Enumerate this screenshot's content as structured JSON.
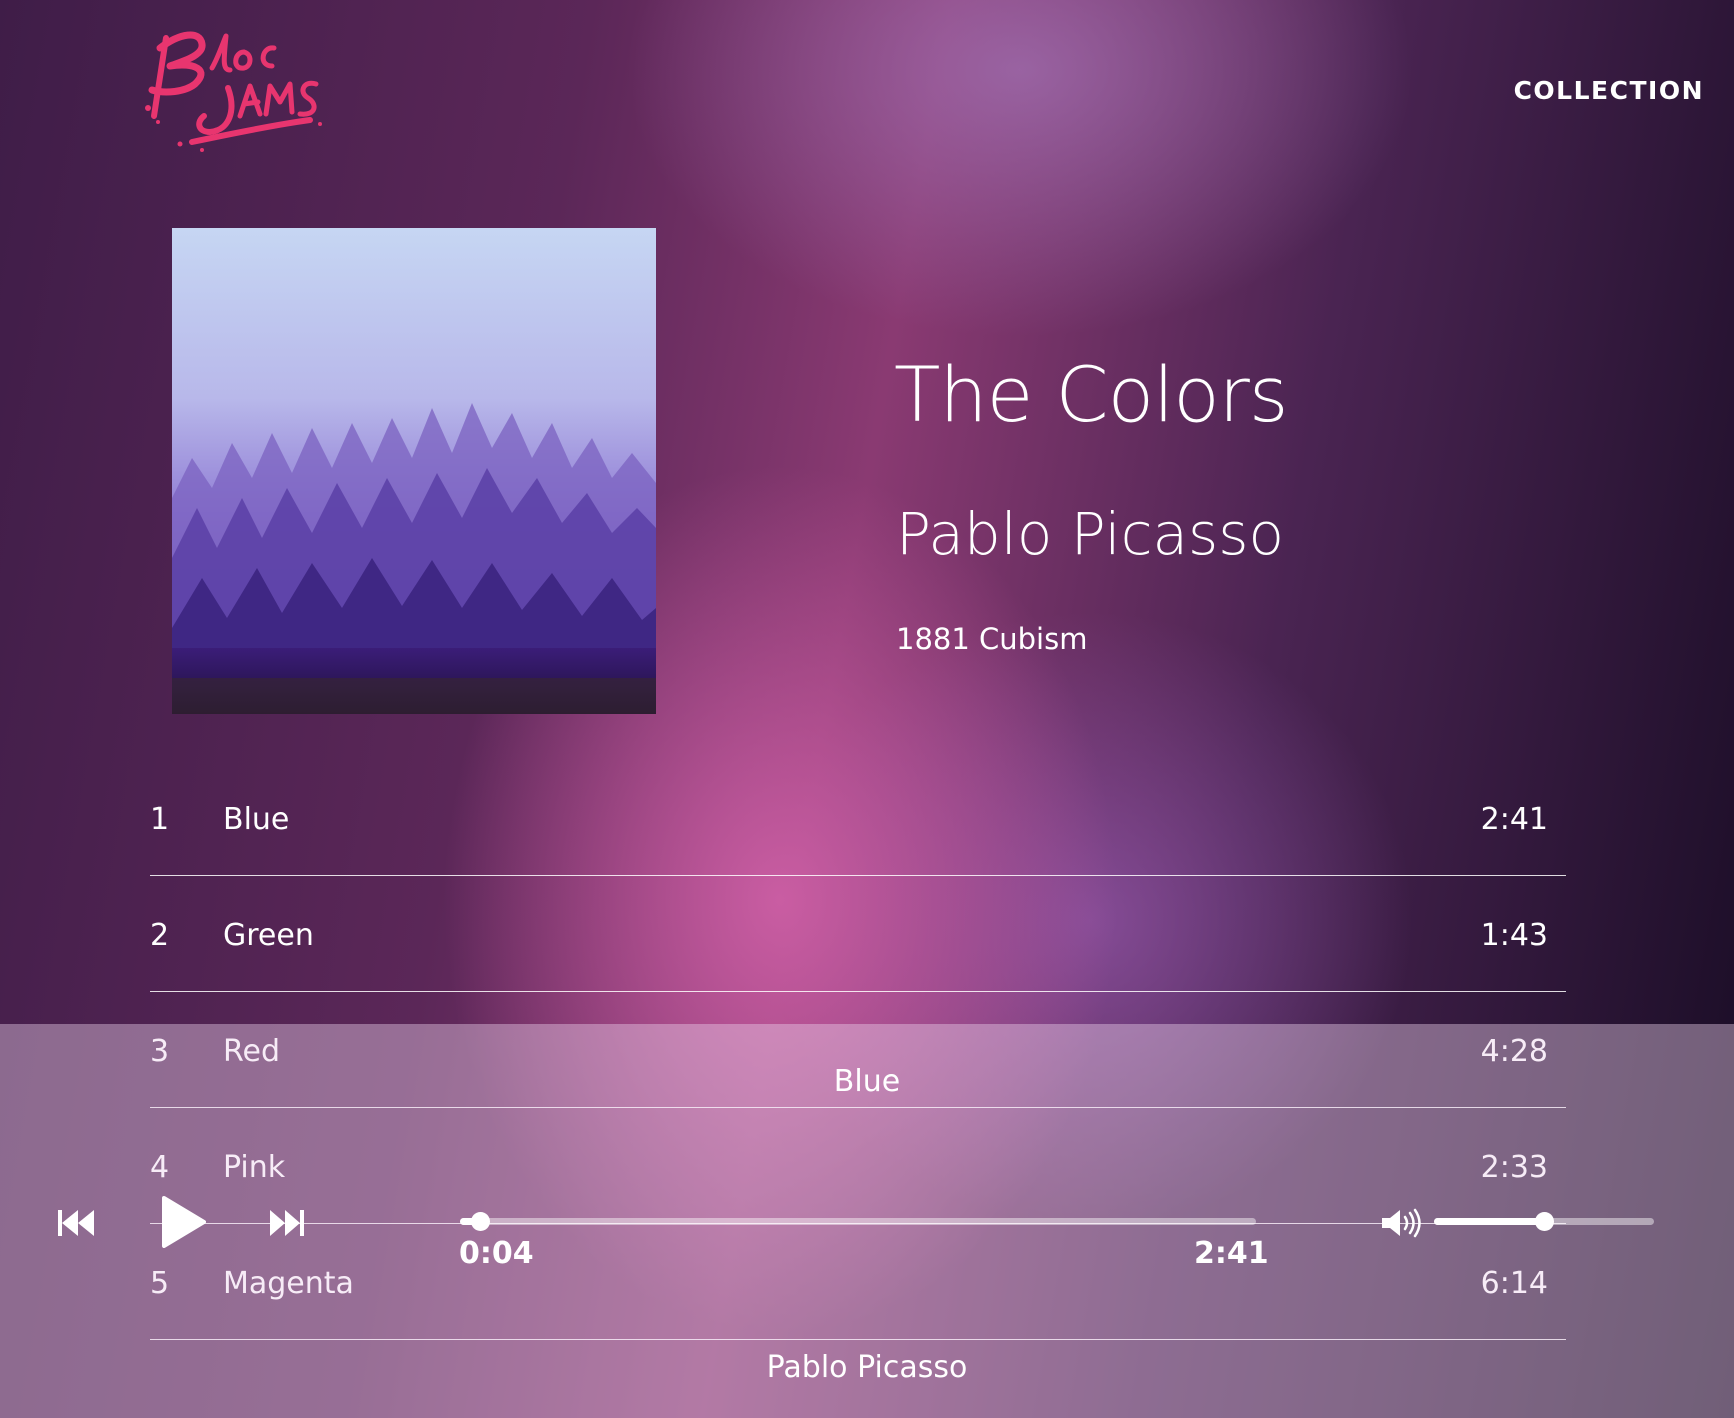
{
  "logo": {
    "text": "Bloc Jams",
    "color": "#e8356f"
  },
  "nav": {
    "collection_label": "COLLECTION"
  },
  "album": {
    "title": "The Colors",
    "artist": "Pablo Picasso",
    "release_info": "1881 Cubism",
    "cover_icon": "misty-forest-album-art"
  },
  "songs": [
    {
      "number": "1",
      "title": "Blue",
      "duration": "2:41"
    },
    {
      "number": "2",
      "title": "Green",
      "duration": "1:43"
    },
    {
      "number": "3",
      "title": "Red",
      "duration": "4:28"
    },
    {
      "number": "4",
      "title": "Pink",
      "duration": "2:33"
    },
    {
      "number": "5",
      "title": "Magenta",
      "duration": "6:14"
    }
  ],
  "player": {
    "now_playing_title": "Blue",
    "now_playing_artist": "Pablo Picasso",
    "current_time": "0:04",
    "total_time": "2:41",
    "seek_progress": 0.025,
    "volume_level": 0.5,
    "icons": [
      "previous-icon",
      "play-icon",
      "next-icon",
      "volume-icon"
    ]
  }
}
